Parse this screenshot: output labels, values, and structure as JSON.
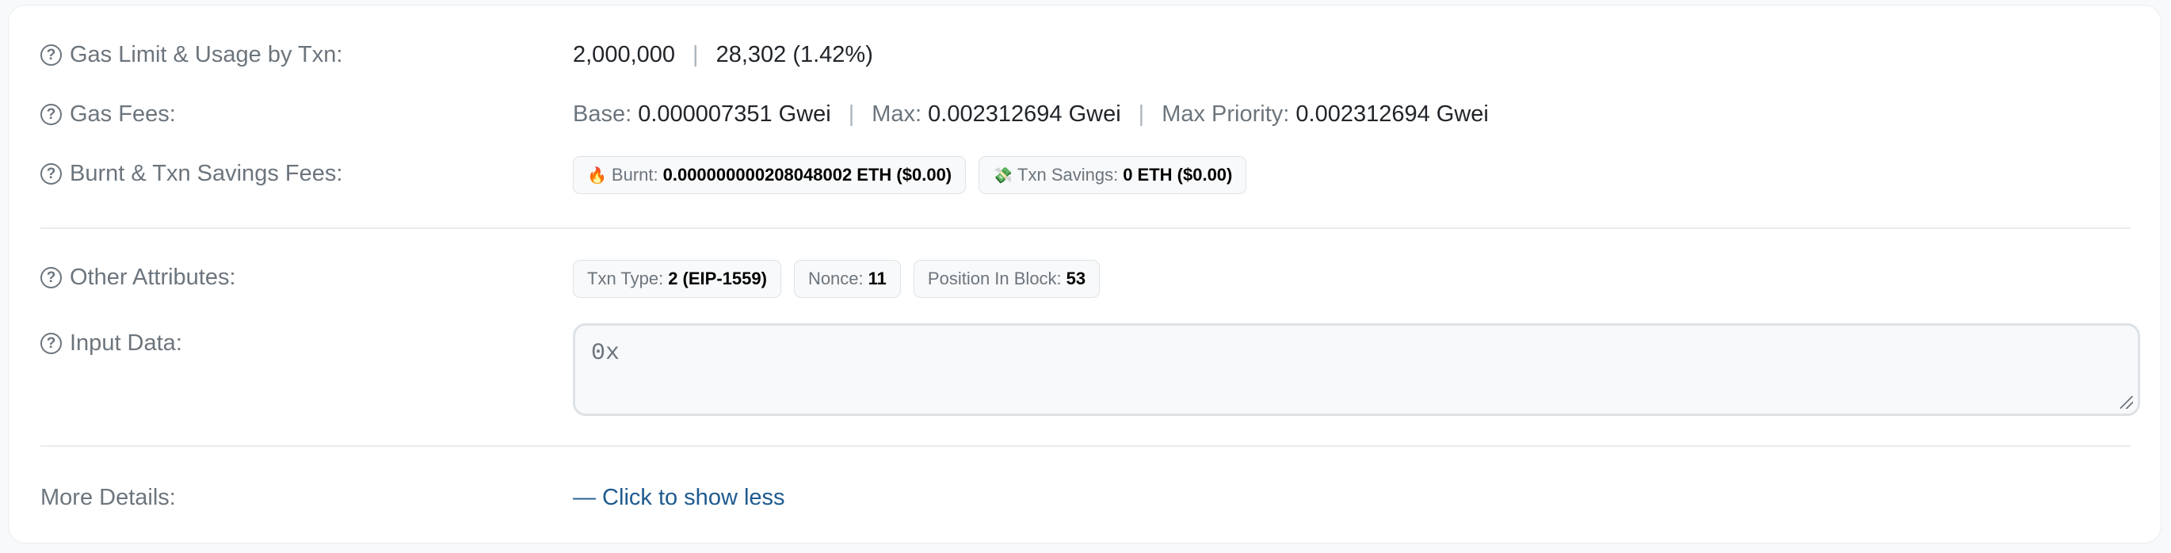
{
  "gas_limit": {
    "label": "Gas Limit & Usage by Txn:",
    "limit": "2,000,000",
    "separator": "|",
    "usage": "28,302 (1.42%)"
  },
  "gas_fees": {
    "label": "Gas Fees:",
    "base_label": "Base:",
    "base_value": "0.000007351 Gwei",
    "max_label": "Max:",
    "max_value": "0.002312694 Gwei",
    "priority_label": "Max Priority:",
    "priority_value": "0.002312694 Gwei"
  },
  "burnt": {
    "label": "Burnt & Txn Savings Fees:",
    "burnt_emoji": "🔥",
    "burnt_label": "Burnt:",
    "burnt_value": "0.000000000208048002 ETH ($0.00)",
    "savings_emoji": "💸",
    "savings_label": "Txn Savings:",
    "savings_value": "0 ETH ($0.00)"
  },
  "other": {
    "label": "Other Attributes:",
    "txn_type_label": "Txn Type:",
    "txn_type_value": "2 (EIP-1559)",
    "nonce_label": "Nonce:",
    "nonce_value": "11",
    "position_label": "Position In Block:",
    "position_value": "53"
  },
  "input": {
    "label": "Input Data:",
    "value": "0x"
  },
  "more": {
    "label": "More Details:",
    "link": "— Click to show less"
  },
  "icons": {
    "help": "question-circle-icon",
    "fire": "fire-icon",
    "money": "money-with-wings-icon"
  }
}
